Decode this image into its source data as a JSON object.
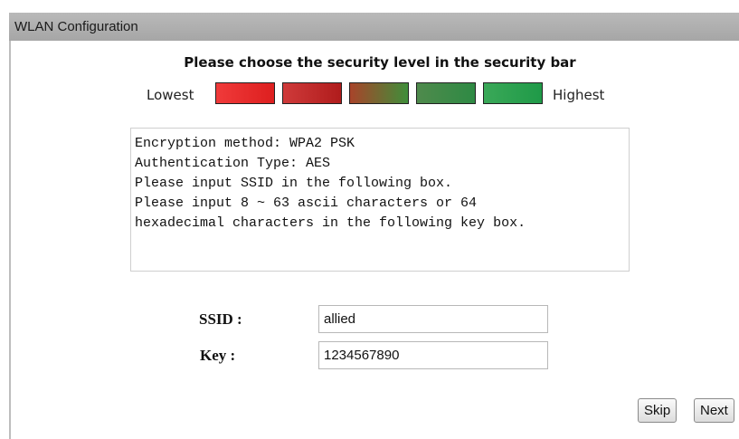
{
  "window": {
    "title": "WLAN Configuration"
  },
  "security": {
    "heading": "Please choose the security level in the security bar",
    "lowest_label": "Lowest",
    "highest_label": "Highest",
    "levels": [
      {
        "name": "level-1",
        "color_start": "#f03a3a",
        "color_end": "#dd1f1f"
      },
      {
        "name": "level-2",
        "color_start": "#cf3a3a",
        "color_end": "#b01c1c"
      },
      {
        "name": "level-3",
        "color_start": "#a8442a",
        "color_end": "#3f8e3a"
      },
      {
        "name": "level-4",
        "color_start": "#4f8a4c",
        "color_end": "#2e8a44"
      },
      {
        "name": "level-5",
        "color_start": "#3aa858",
        "color_end": "#1f9a48"
      }
    ]
  },
  "info": {
    "lines": [
      "Encryption method: WPA2 PSK",
      "Authentication Type: AES",
      "Please input SSID in the following box.",
      "Please input 8 ~ 63 ascii characters or 64",
      "hexadecimal characters in the following key box."
    ]
  },
  "form": {
    "ssid_label": "SSID :",
    "ssid_value": "allied",
    "key_label": "Key :",
    "key_value": "1234567890"
  },
  "buttons": {
    "skip_label": "Skip",
    "next_label": "Next"
  }
}
